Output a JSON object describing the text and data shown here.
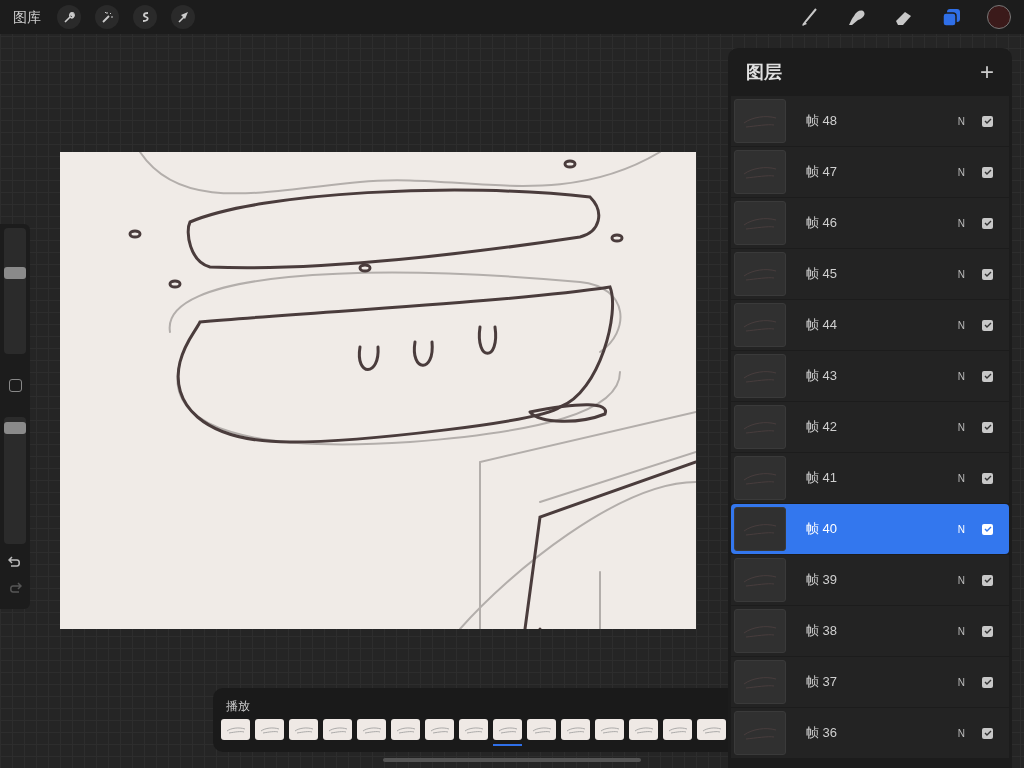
{
  "top_bar": {
    "gallery_label": "图库",
    "actions": [
      {
        "kind": "wrench"
      },
      {
        "kind": "wand"
      },
      {
        "kind": "selection"
      },
      {
        "kind": "transform"
      }
    ],
    "tools": [
      {
        "kind": "brush",
        "selected": false
      },
      {
        "kind": "smudge",
        "selected": false
      },
      {
        "kind": "eraser",
        "selected": false
      },
      {
        "kind": "layers",
        "selected": true
      }
    ],
    "color": "#3b1a1a"
  },
  "sidebar": {
    "size_slider": {
      "level": 0.66
    },
    "opacity_slider": {
      "level": 0.96
    }
  },
  "layers_panel": {
    "title": "图层",
    "add_label": "+",
    "layers": [
      {
        "name": "帧 48",
        "blend": "N",
        "visible": true,
        "selected": false
      },
      {
        "name": "帧 47",
        "blend": "N",
        "visible": true,
        "selected": false
      },
      {
        "name": "帧 46",
        "blend": "N",
        "visible": true,
        "selected": false
      },
      {
        "name": "帧 45",
        "blend": "N",
        "visible": true,
        "selected": false
      },
      {
        "name": "帧 44",
        "blend": "N",
        "visible": true,
        "selected": false
      },
      {
        "name": "帧 43",
        "blend": "N",
        "visible": true,
        "selected": false
      },
      {
        "name": "帧 42",
        "blend": "N",
        "visible": true,
        "selected": false
      },
      {
        "name": "帧 41",
        "blend": "N",
        "visible": true,
        "selected": false
      },
      {
        "name": "帧 40",
        "blend": "N",
        "visible": true,
        "selected": true
      },
      {
        "name": "帧 39",
        "blend": "N",
        "visible": true,
        "selected": false
      },
      {
        "name": "帧 38",
        "blend": "N",
        "visible": true,
        "selected": false
      },
      {
        "name": "帧 37",
        "blend": "N",
        "visible": true,
        "selected": false
      },
      {
        "name": "帧 36",
        "blend": "N",
        "visible": true,
        "selected": false
      }
    ]
  },
  "timeline": {
    "label": "播放",
    "frames": [
      {
        "selected": false
      },
      {
        "selected": false
      },
      {
        "selected": false
      },
      {
        "selected": false
      },
      {
        "selected": false
      },
      {
        "selected": false
      },
      {
        "selected": false
      },
      {
        "selected": false
      },
      {
        "selected": true
      },
      {
        "selected": false
      },
      {
        "selected": false
      },
      {
        "selected": false
      },
      {
        "selected": false
      },
      {
        "selected": false
      },
      {
        "selected": false
      }
    ]
  }
}
